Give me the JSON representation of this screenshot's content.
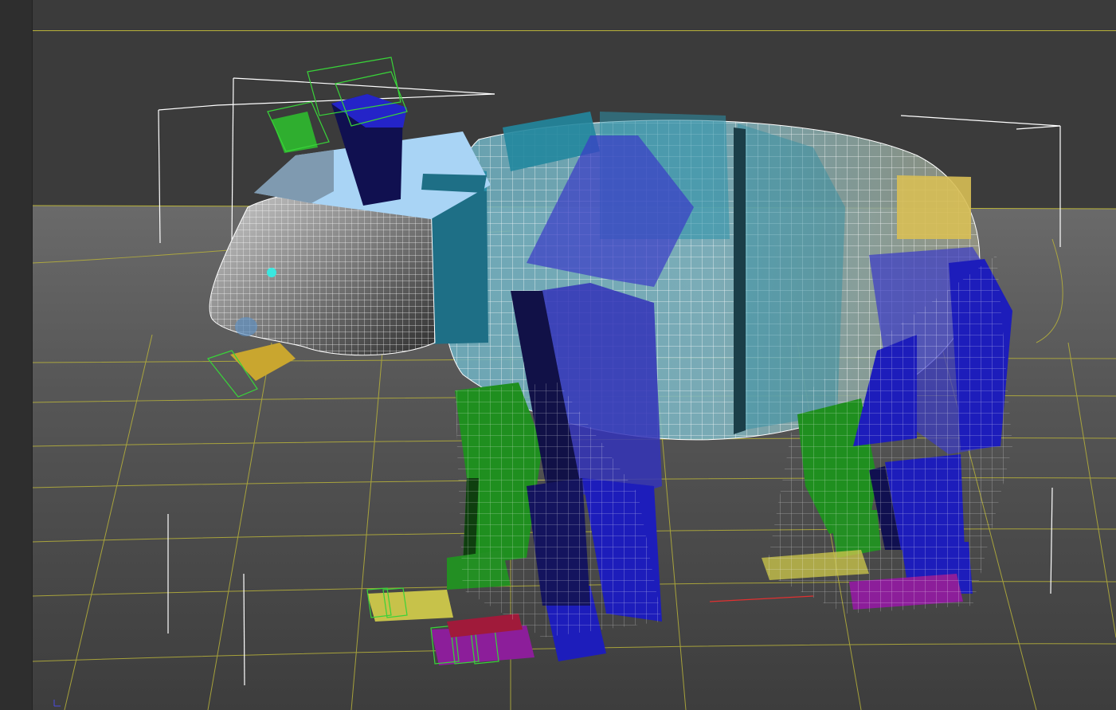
{
  "viewport": {
    "label": "",
    "colors": {
      "background": "#3b3b3b",
      "floor_top": "#5f5f5f",
      "floor_bottom": "#3d3d3d",
      "grid": "#b8b23a",
      "wire": "#ffffff",
      "selection": "#39d339",
      "x_axis": "#e23030"
    }
  },
  "model": {
    "name": "bear",
    "bone_colors": {
      "head": "#a9d4f5",
      "neck": "#1e6f86",
      "spine": "#2a8ea6",
      "pelvis": "#d8bf55",
      "front_leg_far": "#1f8f1f",
      "front_leg_near": "#1d1dbb",
      "rear_leg_far": "#1f8f1f",
      "rear_leg_near": "#1d1dbb",
      "jaw": "#c9a62f",
      "toes_near": "#8c1e9a",
      "toes_far": "#c7c24a",
      "eye": "#39e8e0"
    }
  }
}
